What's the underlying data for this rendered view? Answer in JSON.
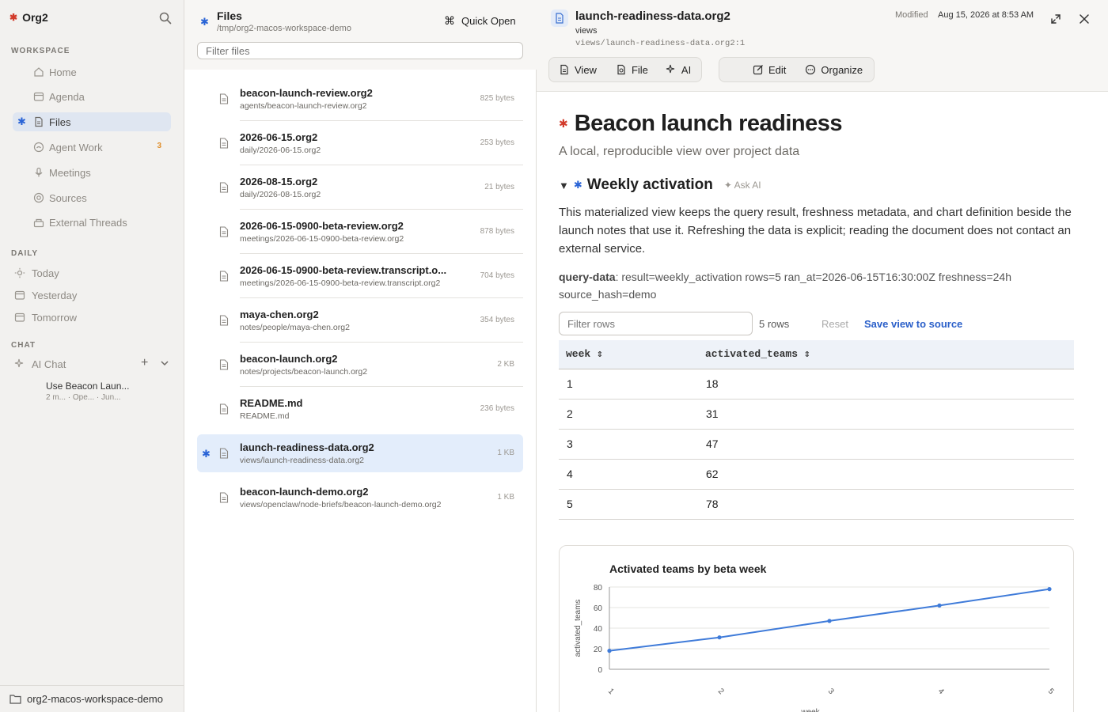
{
  "app": {
    "name": "Org2"
  },
  "sidebar": {
    "workspace_label": "WORKSPACE",
    "workspace_items": [
      {
        "label": "Home",
        "icon": "home-icon"
      },
      {
        "label": "Agenda",
        "icon": "calendar-icon"
      },
      {
        "label": "Files",
        "icon": "file-icon",
        "active": true
      },
      {
        "label": "Agent Work",
        "icon": "agent-icon",
        "badge": "3"
      },
      {
        "label": "Meetings",
        "icon": "microphone-icon"
      },
      {
        "label": "Sources",
        "icon": "sources-icon"
      },
      {
        "label": "External Threads",
        "icon": "threads-icon"
      }
    ],
    "daily_label": "DAILY",
    "daily_items": [
      {
        "label": "Today",
        "icon": "sun-icon"
      },
      {
        "label": "Yesterday",
        "icon": "calendar-icon"
      },
      {
        "label": "Tomorrow",
        "icon": "calendar-icon"
      }
    ],
    "chat_label": "CHAT",
    "chat": {
      "label": "AI Chat",
      "add": "+"
    },
    "chat_entries": [
      {
        "title": "Use Beacon Laun...",
        "meta": "2 m... · Ope... · Jun..."
      }
    ],
    "workspace_name": "org2-macos-workspace-demo"
  },
  "files": {
    "title": "Files",
    "path": "/tmp/org2-macos-workspace-demo",
    "quick_open": "Quick Open",
    "filter_placeholder": "Filter files",
    "rows": [
      {
        "name": "beacon-launch-review.org2",
        "path": "agents/beacon-launch-review.org2",
        "size": "825 bytes"
      },
      {
        "name": "2026-06-15.org2",
        "path": "daily/2026-06-15.org2",
        "size": "253 bytes"
      },
      {
        "name": "2026-08-15.org2",
        "path": "daily/2026-08-15.org2",
        "size": "21 bytes"
      },
      {
        "name": "2026-06-15-0900-beta-review.org2",
        "path": "meetings/2026-06-15-0900-beta-review.org2",
        "size": "878 bytes"
      },
      {
        "name": "2026-06-15-0900-beta-review.transcript.o...",
        "path": "meetings/2026-06-15-0900-beta-review.transcript.org2",
        "size": "704 bytes"
      },
      {
        "name": "maya-chen.org2",
        "path": "notes/people/maya-chen.org2",
        "size": "354 bytes"
      },
      {
        "name": "beacon-launch.org2",
        "path": "notes/projects/beacon-launch.org2",
        "size": "2 KB"
      },
      {
        "name": "README.md",
        "path": "README.md",
        "size": "236 bytes"
      },
      {
        "name": "launch-readiness-data.org2",
        "path": "views/launch-readiness-data.org2",
        "size": "1 KB",
        "active": true
      },
      {
        "name": "beacon-launch-demo.org2",
        "path": "views/openclaw/node-briefs/beacon-launch-demo.org2",
        "size": "1 KB"
      }
    ]
  },
  "doc": {
    "filename": "launch-readiness-data.org2",
    "folder": "views",
    "location": "views/launch-readiness-data.org2:1",
    "modified_label": "Modified",
    "modified_date": "Aug 15, 2026 at 8:53 AM",
    "toolbar": {
      "view": "View",
      "file": "File",
      "ai": "AI",
      "edit": "Edit",
      "organize": "Organize"
    },
    "title": "Beacon launch readiness",
    "subtitle": "A local, reproducible view over project data",
    "heading": "Weekly activation",
    "ask_ai": "✦ Ask AI",
    "paragraph": "This materialized view keeps the query result, freshness metadata, and chart definition beside the launch notes that use it. Refreshing the data is explicit; reading the document does not contact an external service.",
    "query_key": "query-data",
    "query_value": ": result=weekly_activation rows=5 ran_at=2026-06-15T16:30:00Z freshness=24h source_hash=demo",
    "filter_rows_placeholder": "Filter rows",
    "row_count": "5 rows",
    "reset": "Reset",
    "save_view": "Save view to source",
    "table": {
      "columns": [
        "week ⇕",
        "activated_teams ⇕"
      ],
      "rows": [
        [
          "1",
          "18"
        ],
        [
          "2",
          "31"
        ],
        [
          "3",
          "47"
        ],
        [
          "4",
          "62"
        ],
        [
          "5",
          "78"
        ]
      ]
    }
  },
  "chart_data": {
    "type": "line",
    "title": "Activated teams by beta week",
    "xlabel": "week",
    "ylabel": "activated_teams",
    "x": [
      1,
      2,
      3,
      4,
      5
    ],
    "series": [
      {
        "values": [
          18,
          31,
          47,
          62,
          78
        ]
      }
    ],
    "yticks": [
      0,
      20,
      40,
      60,
      80
    ],
    "ylim": [
      0,
      80
    ],
    "grid": true,
    "color": "#3f7bd9"
  },
  "colors": {
    "accent": "#2a64d6",
    "brand_star": "#d23b2b",
    "badge": "#e08e2b"
  }
}
